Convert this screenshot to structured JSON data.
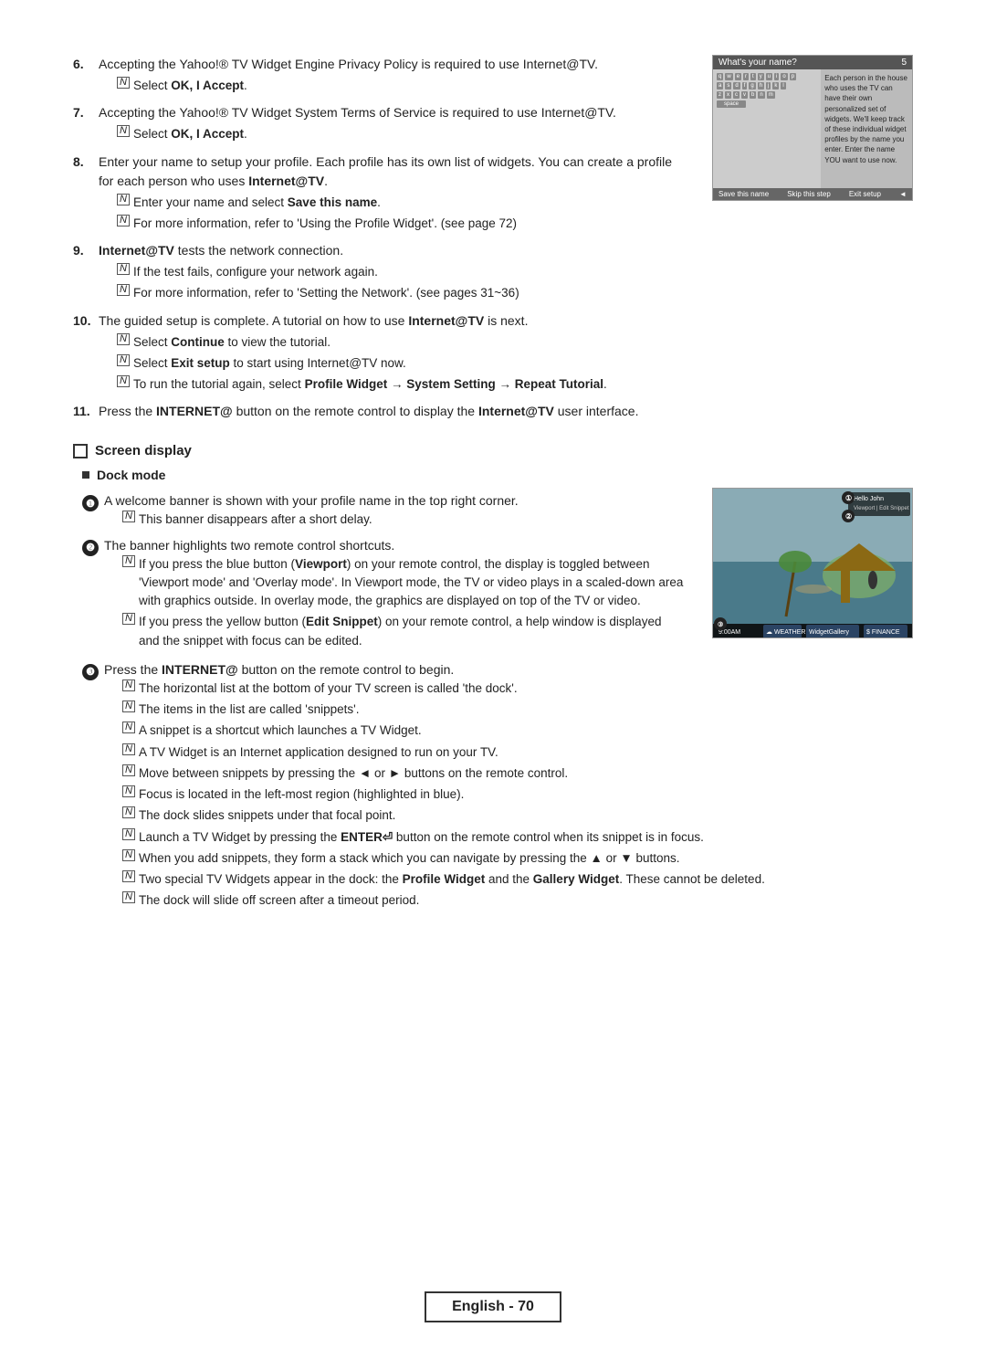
{
  "page": {
    "footer": "English - 70"
  },
  "content": {
    "items": [
      {
        "num": "6.",
        "text": "Accepting the Yahoo!® TV Widget Engine Privacy Policy is required to use Internet@TV.",
        "subitems": [
          {
            "icon": "note",
            "text": "Select <b>OK, I Accept</b>."
          }
        ]
      },
      {
        "num": "7.",
        "text": "Accepting the Yahoo!® TV Widget System Terms of Service is required to use Internet@TV.",
        "subitems": [
          {
            "icon": "note",
            "text": "Select <b>OK, I Accept</b>."
          }
        ]
      },
      {
        "num": "8.",
        "text": "Enter your name to setup your profile. Each profile has its own list of widgets. You can create a profile for each person who uses <b>Internet@TV</b>.",
        "subitems": [
          {
            "icon": "note",
            "text": "Enter your name and select <b>Save this name</b>."
          },
          {
            "icon": "note",
            "text": "For more information, refer to 'Using the Profile Widget'. (see page 72)"
          }
        ]
      },
      {
        "num": "9.",
        "text": "<b>Internet@TV</b> tests the network connection.",
        "subitems": [
          {
            "icon": "note",
            "text": "If the test fails, configure your network again."
          },
          {
            "icon": "note",
            "text": "For more information, refer to 'Setting the Network'. (see pages 31~36)"
          }
        ]
      },
      {
        "num": "10.",
        "text": "The guided setup is complete. A tutorial on how to use <b>Internet@TV</b> is next.",
        "subitems": [
          {
            "icon": "note",
            "text": "Select <b>Continue</b> to view the tutorial."
          },
          {
            "icon": "note",
            "text": "Select <b>Exit setup</b> to start using Internet@TV now."
          },
          {
            "icon": "note",
            "text": "To run the tutorial again, select <b>Profile Widget</b> → <b>System Setting</b> → <b>Repeat Tutorial</b>."
          }
        ]
      },
      {
        "num": "11.",
        "text": "Press the <b>INTERNET@</b> button on the remote control to display the <b>Internet@TV</b> user interface.",
        "subitems": []
      }
    ],
    "screen_display": {
      "heading": "Screen display",
      "subheading": "Dock mode",
      "dock_items": [
        {
          "num": "1",
          "text": "A welcome banner is shown with your profile name in the top right corner.",
          "subitems": [
            {
              "icon": "note",
              "text": "This banner disappears after a short delay."
            }
          ]
        },
        {
          "num": "2",
          "text": "The banner highlights two remote control shortcuts.",
          "subitems": [
            {
              "icon": "note",
              "text": "If you press the blue button (<b>Viewport</b>) on your remote control, the display is toggled between 'Viewport mode' and 'Overlay mode'. In Viewport mode, the TV or video plays in a scaled-down area with graphics outside. In overlay mode, the graphics are displayed on top of the TV or video."
            },
            {
              "icon": "note",
              "text": "If you press the yellow button (<b>Edit Snippet</b>) on your remote control, a help window is displayed and the snippet with focus can be edited."
            }
          ]
        },
        {
          "num": "3",
          "text": "Press the <b>INTERNET@</b> button on the remote control to begin.",
          "subitems": [
            {
              "icon": "note",
              "text": "The horizontal list at the bottom of your TV screen is called 'the dock'."
            },
            {
              "icon": "note",
              "text": "The items in the list are called 'snippets'."
            },
            {
              "icon": "note",
              "text": "A snippet is a shortcut which launches a TV Widget."
            },
            {
              "icon": "note",
              "text": "A TV Widget is an Internet application designed to run on your TV."
            },
            {
              "icon": "note",
              "text": "Move between snippets by pressing the ◄ or ► buttons on the remote control."
            },
            {
              "icon": "note",
              "text": "Focus is located in the left-most region (highlighted in blue)."
            },
            {
              "icon": "note",
              "text": "The dock slides snippets under that focal point."
            },
            {
              "icon": "note",
              "text": "Launch a TV Widget by pressing the ENTER↵ button on the remote control when its snippet is in focus."
            },
            {
              "icon": "note",
              "text": "When you add snippets, they form a stack which you can navigate by pressing the ▲ or ▼ buttons."
            },
            {
              "icon": "note",
              "text": "Two special TV Widgets appear in the dock: the <b>Profile Widget</b> and the <b>Gallery Widget</b>. These cannot be deleted."
            },
            {
              "icon": "note",
              "text": "The dock will slide off screen after a timeout period."
            }
          ]
        }
      ]
    },
    "screenshot1": {
      "title": "What's your name?",
      "badge": "5",
      "keyboard_rows": [
        [
          "q",
          "w",
          "e",
          "r",
          "t",
          "y",
          "u",
          "i",
          "o",
          "p"
        ],
        [
          "a",
          "s",
          "d",
          "f",
          "g",
          "h",
          "j",
          "k",
          "l"
        ],
        [
          "z",
          "x",
          "c",
          "v",
          "b",
          "n",
          "m"
        ]
      ],
      "side_text": "Each person in the house who uses the TV can have their own personalized set of widgets. We'll keep track of these individual widget profiles by the name you enter. Enter the name YOU want to use now.",
      "buttons": [
        "Save this name",
        "Skip this step",
        "Exit setup"
      ]
    },
    "screenshot2": {
      "badge1": "①",
      "badge2": "②",
      "badge3": "③",
      "hello_text": "Hello John",
      "bottom_items": [
        "9:00AM",
        "WEATHER",
        "WidgetGallery",
        "FINANCE"
      ]
    }
  }
}
